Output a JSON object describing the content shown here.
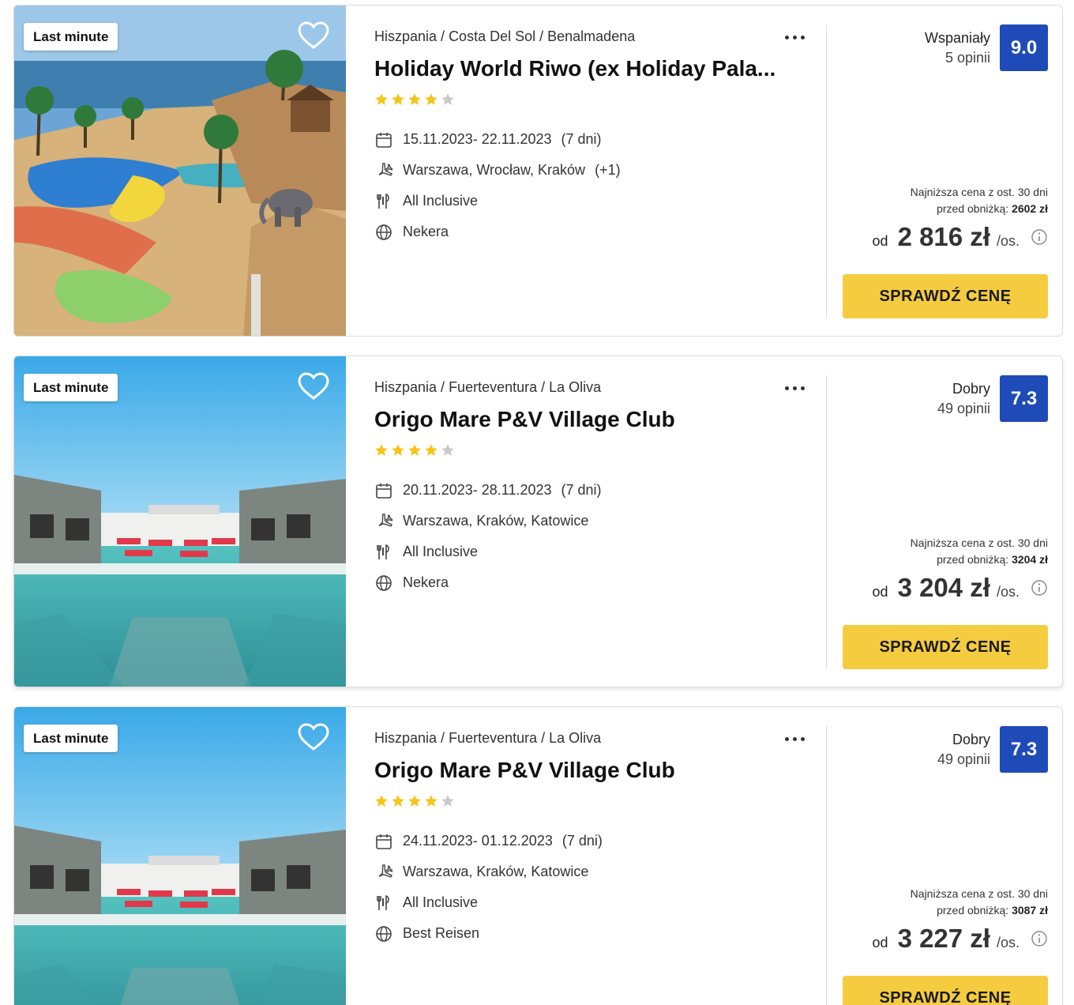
{
  "colors": {
    "score_bg": "#1f4bb8",
    "cta_bg": "#f5cc3f",
    "star_on": "#f5c518",
    "star_off": "#c9c9c9"
  },
  "offers": [
    {
      "badge": "Last minute",
      "image": "resort-pool-sea-elephant-statue",
      "breadcrumb": [
        "Hiszpania",
        "Costa Del Sol",
        "Benalmadena"
      ],
      "title": "Holiday World Riwo (ex Holiday Pala...",
      "stars": 4,
      "stars_max": 5,
      "dates": "15.11.2023- 22.11.2023",
      "duration": "(7 dni)",
      "departures": "Warszawa, Wrocław, Kraków",
      "departures_extra": "(+1)",
      "board": "All Inclusive",
      "operator": "Nekera",
      "rating_word": "Wspaniały",
      "rating_count": "5 opinii",
      "score": "9.0",
      "lowest_line1": "Najniższa cena z ost. 30 dni",
      "lowest_line2": "przed obniżką:",
      "lowest_value": "2602 zł",
      "price_prefix": "od",
      "price": "2 816 zł",
      "price_suffix": "/os.",
      "cta": "SPRAWDŹ CENĘ"
    },
    {
      "badge": "Last minute",
      "image": "hotel-pool-red-sunbeds",
      "breadcrumb": [
        "Hiszpania",
        "Fuerteventura",
        "La Oliva"
      ],
      "title": "Origo Mare P&V Village Club",
      "stars": 4,
      "stars_max": 5,
      "dates": "20.11.2023- 28.11.2023",
      "duration": "(7 dni)",
      "departures": "Warszawa, Kraków, Katowice",
      "departures_extra": "",
      "board": "All Inclusive",
      "operator": "Nekera",
      "rating_word": "Dobry",
      "rating_count": "49 opinii",
      "score": "7.3",
      "lowest_line1": "Najniższa cena z ost. 30 dni",
      "lowest_line2": "przed obniżką:",
      "lowest_value": "3204 zł",
      "price_prefix": "od",
      "price": "3 204 zł",
      "price_suffix": "/os.",
      "cta": "SPRAWDŹ CENĘ"
    },
    {
      "badge": "Last minute",
      "image": "hotel-pool-red-sunbeds",
      "breadcrumb": [
        "Hiszpania",
        "Fuerteventura",
        "La Oliva"
      ],
      "title": "Origo Mare P&V Village Club",
      "stars": 4,
      "stars_max": 5,
      "dates": "24.11.2023- 01.12.2023",
      "duration": "(7 dni)",
      "departures": "Warszawa, Kraków, Katowice",
      "departures_extra": "",
      "board": "All Inclusive",
      "operator": "Best Reisen",
      "rating_word": "Dobry",
      "rating_count": "49 opinii",
      "score": "7.3",
      "lowest_line1": "Najniższa cena z ost. 30 dni",
      "lowest_line2": "przed obniżką:",
      "lowest_value": "3087 zł",
      "price_prefix": "od",
      "price": "3 227 zł",
      "price_suffix": "/os.",
      "cta": "SPRAWDŹ CENĘ"
    }
  ]
}
